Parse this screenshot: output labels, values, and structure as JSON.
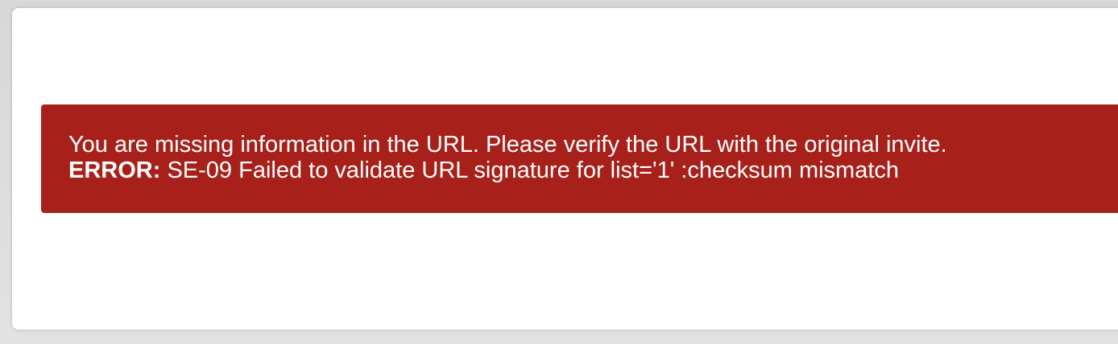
{
  "error_banner": {
    "message": "You are missing information in the URL. Please verify the URL with the original invite.",
    "error_label": "ERROR:",
    "error_detail": "SE-09 Failed to validate URL signature for list='1' :checksum mismatch",
    "background_color": "#a8201a"
  }
}
